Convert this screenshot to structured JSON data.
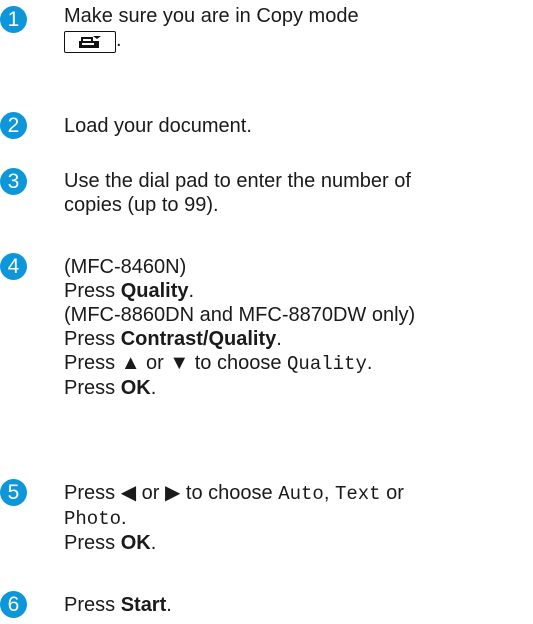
{
  "steps": [
    {
      "number": "1",
      "line1": "Make sure you are in Copy mode",
      "line2_end": "."
    },
    {
      "number": "2",
      "line1": "Load your document."
    },
    {
      "number": "3",
      "line1": "Use the dial pad to enter the number of",
      "line2": "copies (up to 99)."
    },
    {
      "number": "4",
      "model_a": "(MFC-8460N)",
      "press": "Press ",
      "quality": "Quality",
      "period": ".",
      "model_b": "(MFC-8860DN and MFC-8870DW only)",
      "contrast_quality": "Contrast/Quality",
      "up": "▲",
      "or": " or ",
      "down": "▼",
      "to_choose": " to choose ",
      "quality_option": "Quality",
      "ok": "OK"
    },
    {
      "number": "5",
      "press": "Press ",
      "left": "◀",
      "or": " or ",
      "right": "▶",
      "to_choose": " to choose ",
      "opt_auto": "Auto",
      "comma": ", ",
      "opt_text": "Text",
      "or2": " or",
      "opt_photo": "Photo",
      "period": ".",
      "ok": "OK"
    },
    {
      "number": "6",
      "press": "Press ",
      "start": "Start",
      "period": "."
    }
  ],
  "colors": {
    "step_badge": "#0d96d9"
  },
  "icons": {
    "copy_mode_key": "copy-mode-key-icon"
  }
}
